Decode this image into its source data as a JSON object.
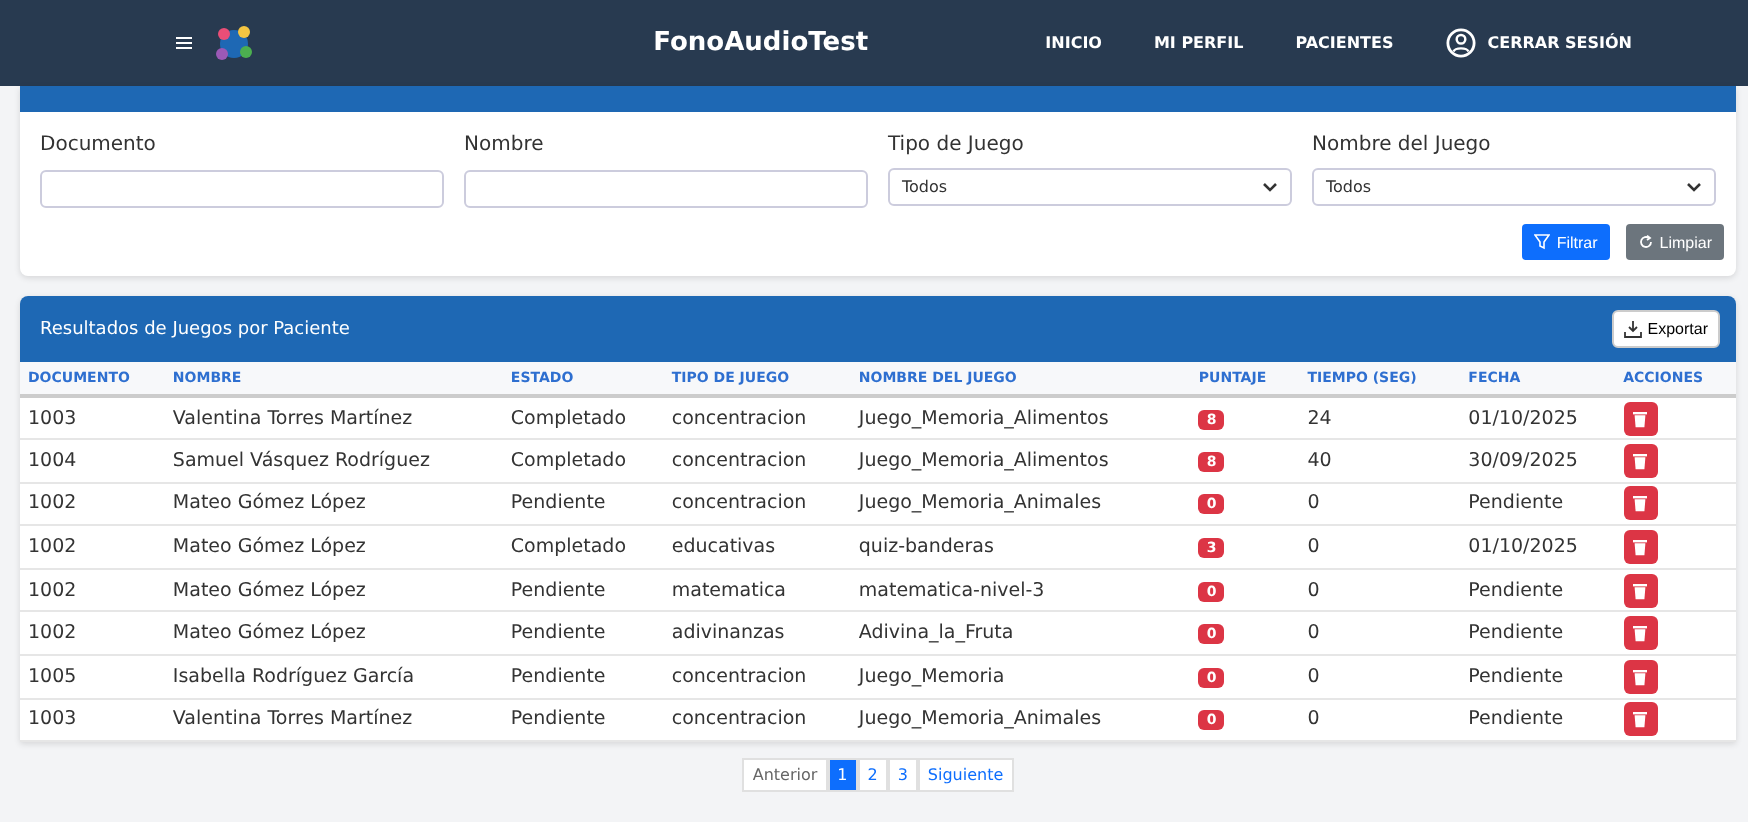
{
  "navbar": {
    "title": "FonoAudioTest",
    "links": [
      "INICIO",
      "MI PERFIL",
      "PACIENTES"
    ],
    "logout": "CERRAR SESIÓN"
  },
  "filters": {
    "fields": [
      {
        "kind": "text",
        "label": "Documento"
      },
      {
        "kind": "text",
        "label": "Nombre"
      },
      {
        "kind": "select",
        "label": "Tipo de Juego",
        "value": "Todos"
      },
      {
        "kind": "select",
        "label": "Nombre del Juego",
        "value": "Todos"
      }
    ],
    "filter_button": "Filtrar",
    "clear_button": "Limpiar"
  },
  "results": {
    "title": "Resultados de Juegos por Paciente",
    "export_button": "Exportar",
    "columns": [
      "DOCUMENTO",
      "NOMBRE",
      "ESTADO",
      "TIPO DE JUEGO",
      "NOMBRE DEL JUEGO",
      "PUNTAJE",
      "TIEMPO (SEG)",
      "FECHA",
      "ACCIONES"
    ],
    "rows": [
      {
        "documento": "1003",
        "nombre": "Valentina Torres Martínez",
        "estado": "Completado",
        "tipo": "concentracion",
        "juego": "Juego_Memoria_Alimentos",
        "puntaje": "8",
        "tiempo": "24",
        "fecha": "01/10/2025"
      },
      {
        "documento": "1004",
        "nombre": "Samuel Vásquez Rodríguez",
        "estado": "Completado",
        "tipo": "concentracion",
        "juego": "Juego_Memoria_Alimentos",
        "puntaje": "8",
        "tiempo": "40",
        "fecha": "30/09/2025"
      },
      {
        "documento": "1002",
        "nombre": "Mateo Gómez López",
        "estado": "Pendiente",
        "tipo": "concentracion",
        "juego": "Juego_Memoria_Animales",
        "puntaje": "0",
        "tiempo": "0",
        "fecha": "Pendiente"
      },
      {
        "documento": "1002",
        "nombre": "Mateo Gómez López",
        "estado": "Completado",
        "tipo": "educativas",
        "juego": "quiz-banderas",
        "puntaje": "3",
        "tiempo": "0",
        "fecha": "01/10/2025"
      },
      {
        "documento": "1002",
        "nombre": "Mateo Gómez López",
        "estado": "Pendiente",
        "tipo": "matematica",
        "juego": "matematica-nivel-3",
        "puntaje": "0",
        "tiempo": "0",
        "fecha": "Pendiente"
      },
      {
        "documento": "1002",
        "nombre": "Mateo Gómez López",
        "estado": "Pendiente",
        "tipo": "adivinanzas",
        "juego": "Adivina_la_Fruta",
        "puntaje": "0",
        "tiempo": "0",
        "fecha": "Pendiente"
      },
      {
        "documento": "1005",
        "nombre": "Isabella Rodríguez García",
        "estado": "Pendiente",
        "tipo": "concentracion",
        "juego": "Juego_Memoria",
        "puntaje": "0",
        "tiempo": "0",
        "fecha": "Pendiente"
      },
      {
        "documento": "1003",
        "nombre": "Valentina Torres Martínez",
        "estado": "Pendiente",
        "tipo": "concentracion",
        "juego": "Juego_Memoria_Animales",
        "puntaje": "0",
        "tiempo": "0",
        "fecha": "Pendiente"
      }
    ]
  },
  "pagination": {
    "previous": "Anterior",
    "pages": [
      {
        "label": "1",
        "selected": true
      },
      {
        "label": "2",
        "selected": false
      },
      {
        "label": "3",
        "selected": false
      }
    ],
    "next": "Siguiente"
  }
}
